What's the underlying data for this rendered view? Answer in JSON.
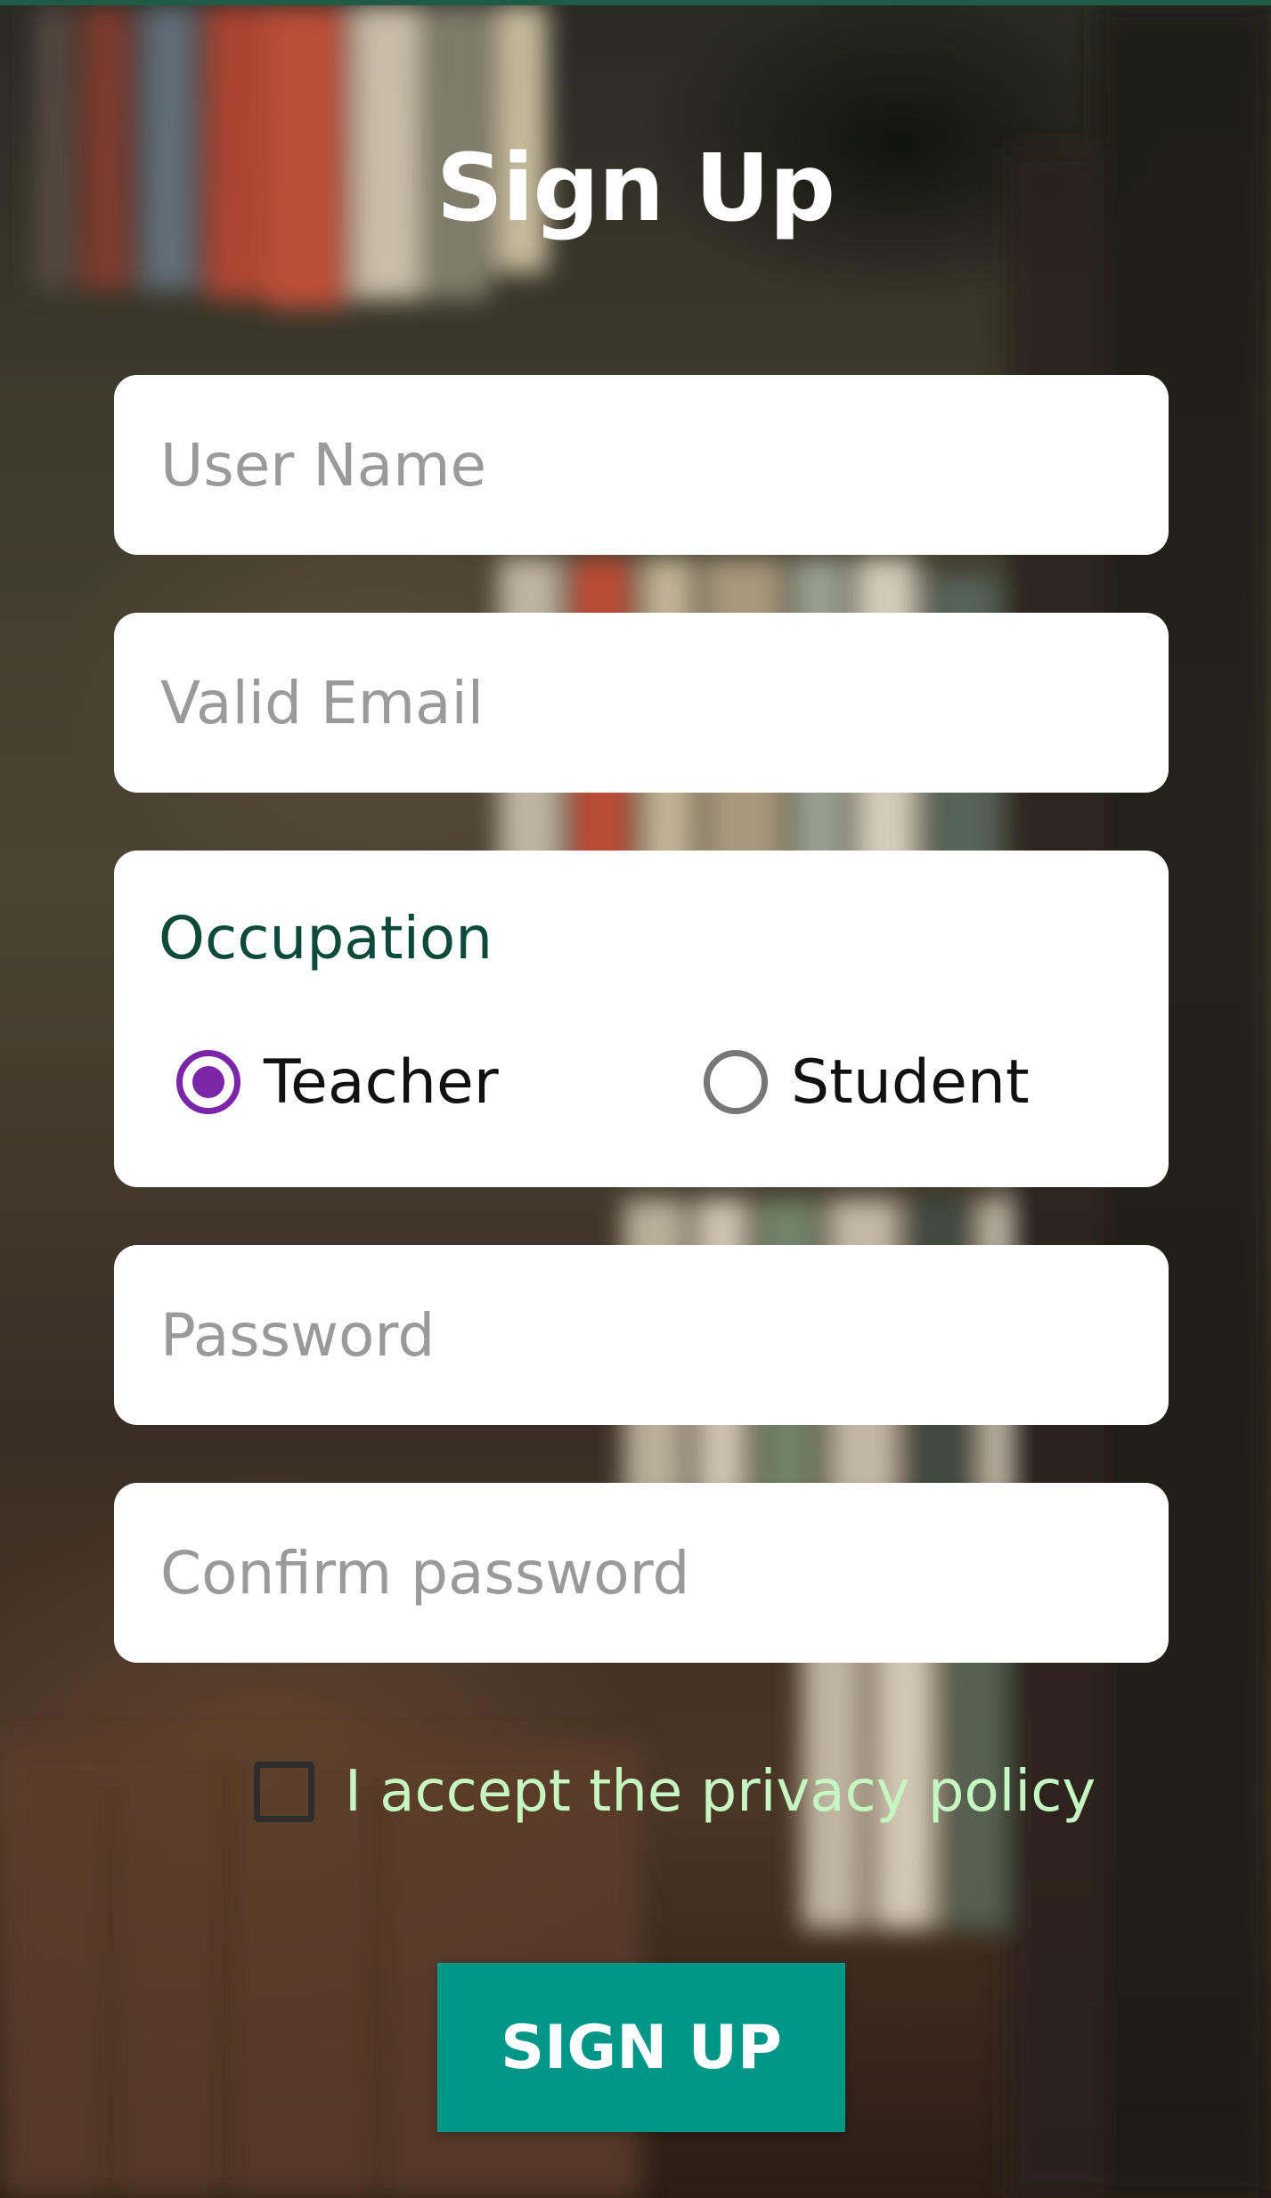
{
  "title": "Sign Up",
  "fields": {
    "username_placeholder": "User Name",
    "email_placeholder": "Valid Email",
    "password_placeholder": "Password",
    "confirm_placeholder": "Confirm password"
  },
  "occupation": {
    "label": "Occupation",
    "options": [
      {
        "label": "Teacher",
        "selected": true
      },
      {
        "label": "Student",
        "selected": false
      }
    ]
  },
  "privacy": {
    "label": "I accept the privacy policy",
    "checked": false
  },
  "button": {
    "label": "SIGN UP"
  },
  "colors": {
    "accent": "#009688",
    "radio_selected": "#7b25a8",
    "occupation_label": "#0d4a3a",
    "privacy_text": "#c6f7c2",
    "top_bar": "#1e5c45"
  }
}
